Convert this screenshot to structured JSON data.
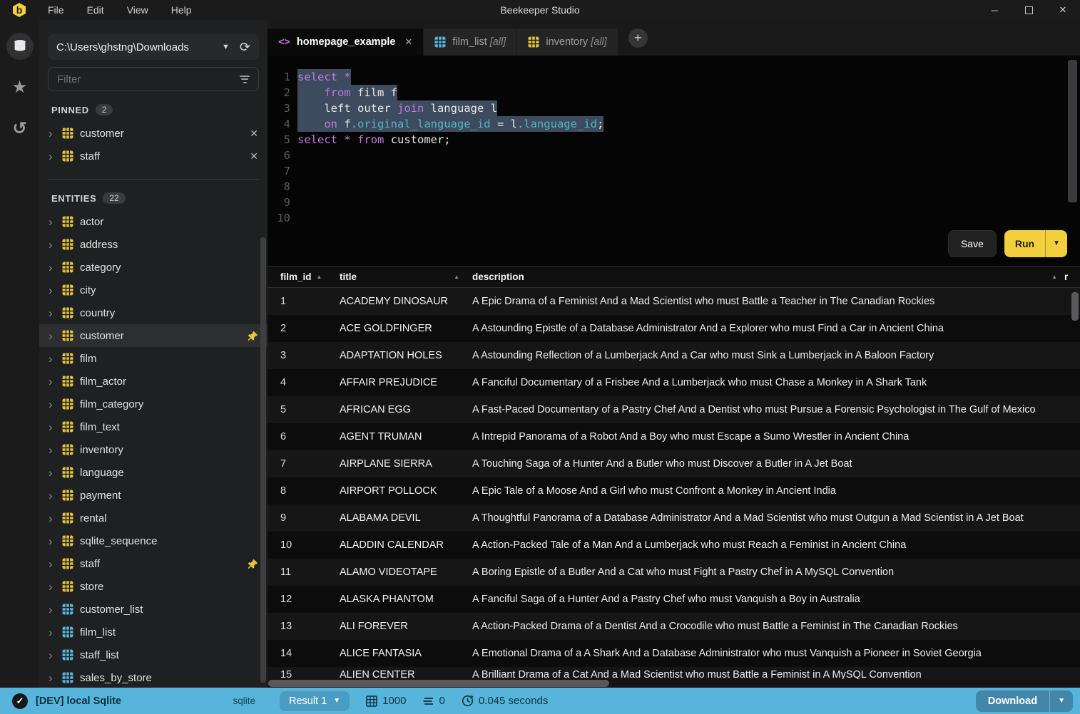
{
  "colors": {
    "accent_yellow": "#f2cf3d",
    "statusbar_blue": "#57b5dc",
    "keyword_pink": "#c678dd",
    "field_cyan": "#56b6c2",
    "selection": "#3c4b5d",
    "view_icon_blue": "#58b7dd",
    "table_icon_yellow": "#e5c43c"
  },
  "titlebar": {
    "app_title": "Beekeeper Studio",
    "menus": [
      "File",
      "Edit",
      "View",
      "Help"
    ],
    "logo_letter": "b"
  },
  "sidebar": {
    "connection": {
      "value": "C:\\Users\\ghstng\\Downloads"
    },
    "filter": {
      "placeholder": "Filter"
    },
    "pinned": {
      "label": "PINNED",
      "count": "2",
      "items": [
        {
          "label": "customer",
          "type": "table"
        },
        {
          "label": "staff",
          "type": "table"
        }
      ]
    },
    "entities": {
      "label": "ENTITIES",
      "count": "22",
      "items": [
        {
          "label": "actor",
          "type": "table"
        },
        {
          "label": "address",
          "type": "table"
        },
        {
          "label": "category",
          "type": "table"
        },
        {
          "label": "city",
          "type": "table"
        },
        {
          "label": "country",
          "type": "table"
        },
        {
          "label": "customer",
          "type": "table",
          "pinned": true,
          "active": true
        },
        {
          "label": "film",
          "type": "table"
        },
        {
          "label": "film_actor",
          "type": "table"
        },
        {
          "label": "film_category",
          "type": "table"
        },
        {
          "label": "film_text",
          "type": "table"
        },
        {
          "label": "inventory",
          "type": "table"
        },
        {
          "label": "language",
          "type": "table"
        },
        {
          "label": "payment",
          "type": "table"
        },
        {
          "label": "rental",
          "type": "table"
        },
        {
          "label": "sqlite_sequence",
          "type": "table"
        },
        {
          "label": "staff",
          "type": "table",
          "pinned": true
        },
        {
          "label": "store",
          "type": "table"
        },
        {
          "label": "customer_list",
          "type": "view"
        },
        {
          "label": "film_list",
          "type": "view"
        },
        {
          "label": "staff_list",
          "type": "view"
        },
        {
          "label": "sales_by_store",
          "type": "view"
        }
      ]
    }
  },
  "tabs": [
    {
      "label": "homepage_example",
      "icon": "code",
      "active": true,
      "closable": true
    },
    {
      "label": "film_list",
      "suffix": "[all]",
      "icon": "view"
    },
    {
      "label": "inventory",
      "suffix": "[all]",
      "icon": "table"
    }
  ],
  "editor": {
    "total_lines": 10,
    "lines": [
      {
        "n": 1,
        "selected": true,
        "tokens": [
          [
            "kw",
            "select"
          ],
          [
            "tx",
            " "
          ],
          [
            "kw",
            "*"
          ]
        ]
      },
      {
        "n": 2,
        "selected": true,
        "tokens": [
          [
            "tx",
            "    "
          ],
          [
            "kw",
            "from"
          ],
          [
            "tx",
            " film f"
          ]
        ]
      },
      {
        "n": 3,
        "selected": true,
        "tokens": [
          [
            "tx",
            "    left outer "
          ],
          [
            "kw",
            "join"
          ],
          [
            "tx",
            " language l"
          ]
        ]
      },
      {
        "n": 4,
        "selected": true,
        "tokens": [
          [
            "tx",
            "    "
          ],
          [
            "kw",
            "on"
          ],
          [
            "tx",
            " f"
          ],
          [
            "fd",
            ".original_language_id"
          ],
          [
            "tx",
            " = l"
          ],
          [
            "fd",
            ".language_id"
          ],
          [
            "tx",
            ";"
          ]
        ]
      },
      {
        "n": 5,
        "selected": false,
        "tokens": [
          [
            "kw",
            "select"
          ],
          [
            "tx",
            " "
          ],
          [
            "kw",
            "*"
          ],
          [
            "tx",
            " "
          ],
          [
            "kw",
            "from"
          ],
          [
            "tx",
            " customer;"
          ]
        ]
      }
    ]
  },
  "toolbar": {
    "save_label": "Save",
    "run_label": "Run"
  },
  "results": {
    "columns": [
      {
        "label": "film_id"
      },
      {
        "label": "title"
      },
      {
        "label": "description"
      },
      {
        "label": "r"
      }
    ],
    "rows": [
      {
        "film_id": "1",
        "title": "ACADEMY DINOSAUR",
        "description": "A Epic Drama of a Feminist And a Mad Scientist who must Battle a Teacher in The Canadian Rockies"
      },
      {
        "film_id": "2",
        "title": "ACE GOLDFINGER",
        "description": "A Astounding Epistle of a Database Administrator And a Explorer who must Find a Car in Ancient China"
      },
      {
        "film_id": "3",
        "title": "ADAPTATION HOLES",
        "description": "A Astounding Reflection of a Lumberjack And a Car who must Sink a Lumberjack in A Baloon Factory"
      },
      {
        "film_id": "4",
        "title": "AFFAIR PREJUDICE",
        "description": "A Fanciful Documentary of a Frisbee And a Lumberjack who must Chase a Monkey in A Shark Tank"
      },
      {
        "film_id": "5",
        "title": "AFRICAN EGG",
        "description": "A Fast-Paced Documentary of a Pastry Chef And a Dentist who must Pursue a Forensic Psychologist in The Gulf of Mexico"
      },
      {
        "film_id": "6",
        "title": "AGENT TRUMAN",
        "description": "A Intrepid Panorama of a Robot And a Boy who must Escape a Sumo Wrestler in Ancient China"
      },
      {
        "film_id": "7",
        "title": "AIRPLANE SIERRA",
        "description": "A Touching Saga of a Hunter And a Butler who must Discover a Butler in A Jet Boat"
      },
      {
        "film_id": "8",
        "title": "AIRPORT POLLOCK",
        "description": "A Epic Tale of a Moose And a Girl who must Confront a Monkey in Ancient India"
      },
      {
        "film_id": "9",
        "title": "ALABAMA DEVIL",
        "description": "A Thoughtful Panorama of a Database Administrator And a Mad Scientist who must Outgun a Mad Scientist in A Jet Boat"
      },
      {
        "film_id": "10",
        "title": "ALADDIN CALENDAR",
        "description": "A Action-Packed Tale of a Man And a Lumberjack who must Reach a Feminist in Ancient China"
      },
      {
        "film_id": "11",
        "title": "ALAMO VIDEOTAPE",
        "description": "A Boring Epistle of a Butler And a Cat who must Fight a Pastry Chef in A MySQL Convention"
      },
      {
        "film_id": "12",
        "title": "ALASKA PHANTOM",
        "description": "A Fanciful Saga of a Hunter And a Pastry Chef who must Vanquish a Boy in Australia"
      },
      {
        "film_id": "13",
        "title": "ALI FOREVER",
        "description": "A Action-Packed Drama of a Dentist And a Crocodile who must Battle a Feminist in The Canadian Rockies"
      },
      {
        "film_id": "14",
        "title": "ALICE FANTASIA",
        "description": "A Emotional Drama of a A Shark And a Database Administrator who must Vanquish a Pioneer in Soviet Georgia"
      },
      {
        "film_id": "15",
        "title": "ALIEN CENTER",
        "description": "A Brilliant Drama of a Cat And a Mad Scientist who must Battle a Feminist in A MySQL Convention",
        "partial": true
      }
    ]
  },
  "statusbar": {
    "connection_label": "[DEV] local Sqlite",
    "connection_type": "sqlite",
    "result_selector": "Result 1",
    "row_count": "1000",
    "affected_count": "0",
    "elapsed": "0.045 seconds",
    "download_label": "Download"
  }
}
